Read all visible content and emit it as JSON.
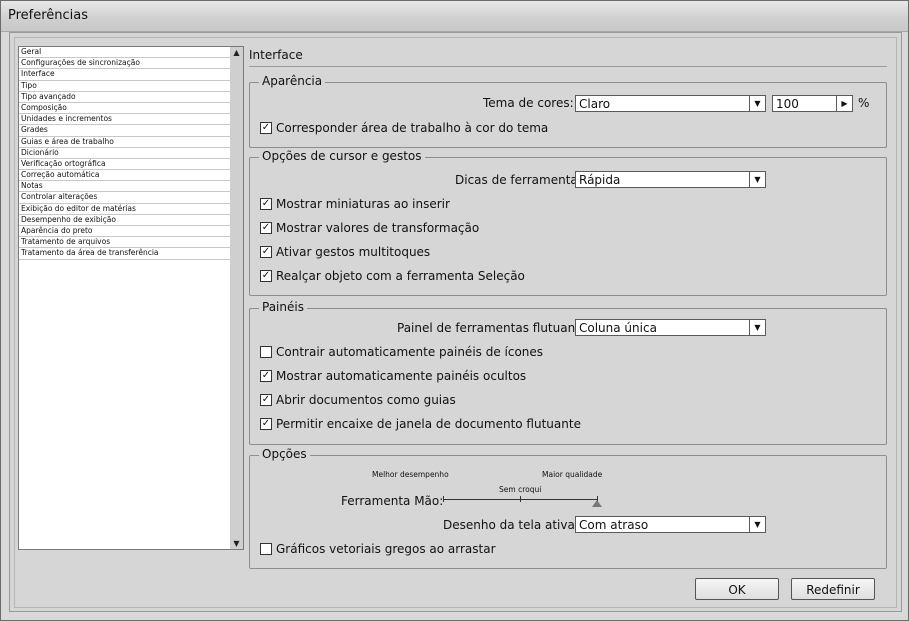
{
  "window": {
    "title": "Preferências"
  },
  "sidebar": {
    "items": [
      "Geral",
      "Configurações de sincronização",
      "Interface",
      "Tipo",
      "Tipo avançado",
      "Composição",
      "Unidades e incrementos",
      "Grades",
      "Guias e área de trabalho",
      "Dicionário",
      "Verificação ortográfica",
      "Correção automática",
      "Notas",
      "Controlar alterações",
      "Exibição do editor de matérias",
      "Desempenho de exibição",
      "Aparência do preto",
      "Tratamento de arquivos",
      "Tratamento da área de transferência"
    ],
    "scroll_up_icon": "▲",
    "scroll_down_icon": "▼"
  },
  "panel": {
    "heading": "Interface",
    "aparencia": {
      "legend": "Aparência",
      "tema_label": "Tema de cores:",
      "tema_value": "Claro",
      "brightness_value": "100",
      "percent": "%",
      "match_label": "Corresponder área de trabalho à cor do tema",
      "match_checked": true
    },
    "cursor": {
      "legend": "Opções de cursor e gestos",
      "dicas_label": "Dicas de ferramenta:",
      "dicas_value": "Rápida",
      "checks": [
        {
          "label": "Mostrar miniaturas ao inserir",
          "checked": true
        },
        {
          "label": "Mostrar valores de transformação",
          "checked": true
        },
        {
          "label": "Ativar gestos multitoques",
          "checked": true
        },
        {
          "label": "Realçar objeto com a ferramenta Seleção",
          "checked": true
        }
      ]
    },
    "paineis": {
      "legend": "Painéis",
      "painel_label": "Painel de ferramentas flutuante:",
      "painel_value": "Coluna única",
      "checks": [
        {
          "label": "Contrair automaticamente painéis de ícones",
          "checked": false
        },
        {
          "label": "Mostrar automaticamente painéis ocultos",
          "checked": true
        },
        {
          "label": "Abrir documentos como guias",
          "checked": true
        },
        {
          "label": "Permitir encaixe de janela de documento flutuante",
          "checked": true
        }
      ]
    },
    "opcoes": {
      "legend": "Opções",
      "slider_left": "Melhor desempenho",
      "slider_right": "Maior qualidade",
      "slider_mid": "Sem croqui",
      "mao_label": "Ferramenta Mão:",
      "slider_level": 1.0,
      "desenho_label": "Desenho da tela ativa:",
      "desenho_value": "Com atraso",
      "vetoriais_label": "Gráficos vetoriais gregos ao arrastar",
      "vetoriais_checked": false
    }
  },
  "buttons": {
    "ok": "OK",
    "reset": "Redefinir"
  },
  "icons": {
    "check": "✓",
    "dropdown": "▼",
    "stepper": "▶"
  }
}
